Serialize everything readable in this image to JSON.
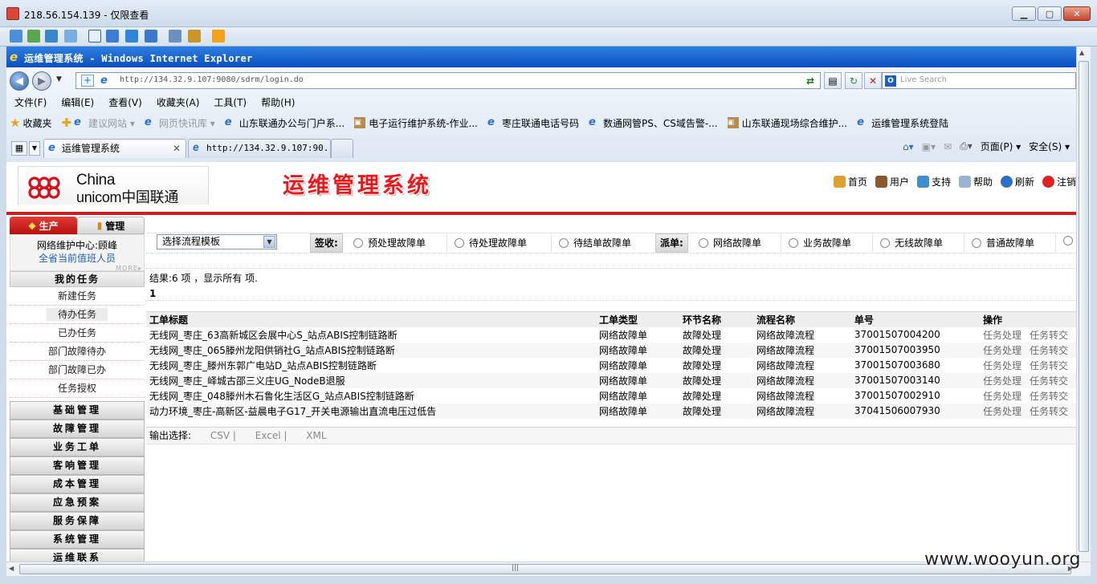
{
  "rdp": {
    "title": "218.56.154.139 - 仅限查看"
  },
  "ie": {
    "title": "运维管理系统 - Windows Internet Explorer",
    "url": "http://134.32.9.107:9080/sdrm/login.do",
    "search_placeholder": "Live Search",
    "menu": [
      "文件(F)",
      "编辑(E)",
      "查看(V)",
      "收藏夹(A)",
      "工具(T)",
      "帮助(H)"
    ],
    "favorites_label": "收藏夹",
    "favorites": [
      "建议网站 ▾",
      "网页快讯库 ▾",
      "山东联通办公与门户系...",
      "电子运行维护系统-作业...",
      "枣庄联通电话号码",
      "数通网管PS、CS域告警-...",
      "山东联通现场综合维护...",
      "运维管理系统登陆"
    ],
    "tabs": [
      {
        "label": "运维管理系统"
      },
      {
        "label": "http://134.32.9.107:90..."
      }
    ],
    "commands": [
      "页面(P) ▾",
      "安全(S) ▾"
    ]
  },
  "header": {
    "logo_line1": "China",
    "logo_line2": "unicom中国联通",
    "system_title": "运维管理系统",
    "links": [
      "首页",
      "用户",
      "支持",
      "帮助",
      "刷新",
      "注销"
    ]
  },
  "sidebar": {
    "tabs": [
      "生产",
      "管理"
    ],
    "info_line1": "网络维护中心:顾峰",
    "info_line2": "全省当前值班人员",
    "more": "MORE▸",
    "my_tasks_title": "我的任务",
    "my_tasks": [
      "新建任务",
      "待办任务",
      "已办任务",
      "部门故障待办",
      "部门故障已办",
      "任务授权"
    ],
    "groups": [
      "基础管理",
      "故障管理",
      "业务工单",
      "客响管理",
      "成本管理",
      "应急预案",
      "服务保障",
      "系统管理",
      "运维联系"
    ]
  },
  "filter": {
    "template_select": "选择流程模板",
    "sign_label": "签收:",
    "sign_options": [
      "预处理故障单",
      "待处理故障单",
      "待结单故障单"
    ],
    "dispatch_label": "派单:",
    "dispatch_options": [
      "网络故障单",
      "业务故障单",
      "无线故障单",
      "普通故障单"
    ]
  },
  "results": {
    "summary": "结果:6 项 ，显示所有 项.",
    "page": "1"
  },
  "table": {
    "headers": [
      "工单标题",
      "工单类型",
      "环节名称",
      "流程名称",
      "单号",
      "操作"
    ],
    "rows": [
      {
        "title": "无线网_枣庄_63高新城区会展中心S_站点ABIS控制链路断",
        "type": "网络故障单",
        "step": "故障处理",
        "flow": "网络故障流程",
        "no": "37001507004200"
      },
      {
        "title": "无线网_枣庄_065滕州龙阳供销社G_站点ABIS控制链路断",
        "type": "网络故障单",
        "step": "故障处理",
        "flow": "网络故障流程",
        "no": "37001507003950"
      },
      {
        "title": "无线网_枣庄_滕州东郭广电站D_站点ABIS控制链路断",
        "type": "网络故障单",
        "step": "故障处理",
        "flow": "网络故障流程",
        "no": "37001507003680"
      },
      {
        "title": "无线网_枣庄_峄城古邵三义庄UG_NodeB退服",
        "type": "网络故障单",
        "step": "故障处理",
        "flow": "网络故障流程",
        "no": "37001507003140"
      },
      {
        "title": "无线网_枣庄_048滕州木石鲁化生活区G_站点ABIS控制链路断",
        "type": "网络故障单",
        "step": "故障处理",
        "flow": "网络故障流程",
        "no": "37001507002910"
      },
      {
        "title": "动力环境_枣庄-高新区-益晨电子G17_开关电源输出直流电压过低告",
        "type": "网络故障单",
        "step": "故障处理",
        "flow": "网络故障流程",
        "no": "37041506007930"
      }
    ],
    "action_process": "任务处理",
    "action_transfer": "任务转交"
  },
  "export": {
    "label": "输出选择:",
    "csv": "CSV |",
    "excel": "Excel |",
    "xml": "XML"
  },
  "watermark": "www.wooyun.org"
}
